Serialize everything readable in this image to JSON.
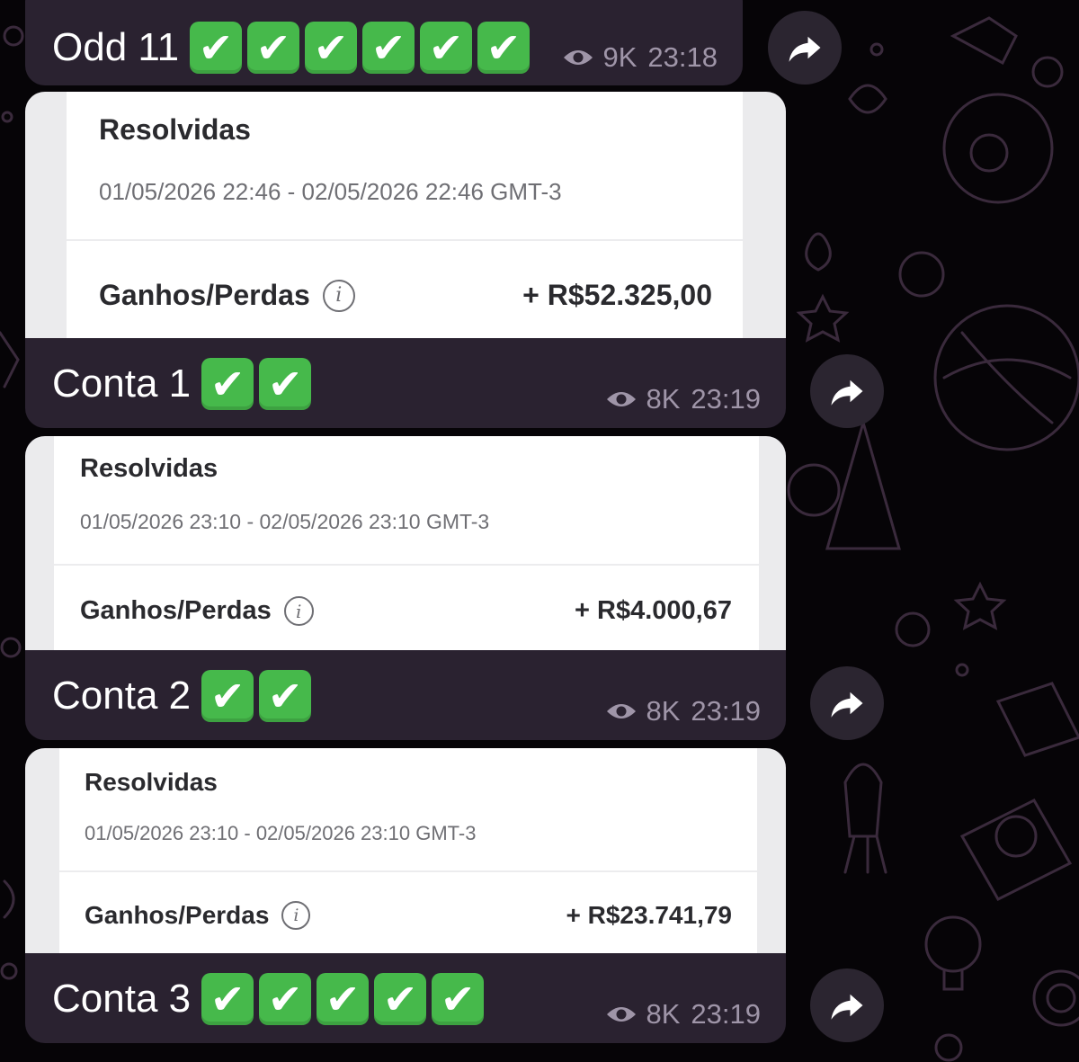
{
  "messages": [
    {
      "caption": "Odd 11",
      "checks": 6,
      "views": "9K",
      "time": "23:18"
    },
    {
      "caption": "Conta 1",
      "checks": 2,
      "views": "8K",
      "time": "23:19",
      "screenshot": {
        "title": "Resolvidas",
        "date_range": "01/05/2026 22:46 - 02/05/2026 22:46 GMT-3",
        "label": "Ganhos/Perdas",
        "value": "+ R$52.325,00"
      }
    },
    {
      "caption": "Conta 2",
      "checks": 2,
      "views": "8K",
      "time": "23:19",
      "screenshot": {
        "title": "Resolvidas",
        "date_range": "01/05/2026 23:10 - 02/05/2026 23:10 GMT-3",
        "label": "Ganhos/Perdas",
        "value": "+ R$4.000,67"
      }
    },
    {
      "caption": "Conta 3",
      "checks": 5,
      "views": "8K",
      "time": "23:19",
      "screenshot": {
        "title": "Resolvidas",
        "date_range": "01/05/2026 23:10 - 02/05/2026 23:10 GMT-3",
        "label": "Ganhos/Perdas",
        "value": "+ R$23.741,79"
      }
    }
  ],
  "icons": {
    "check": "check-mark-button-emoji",
    "views": "eye-icon",
    "forward": "forward-arrow-icon",
    "info": "info-icon"
  },
  "colors": {
    "background": "#060407",
    "bubble": "#2a2230",
    "check_green": "#46b94b",
    "meta_text": "#9f95a8"
  }
}
